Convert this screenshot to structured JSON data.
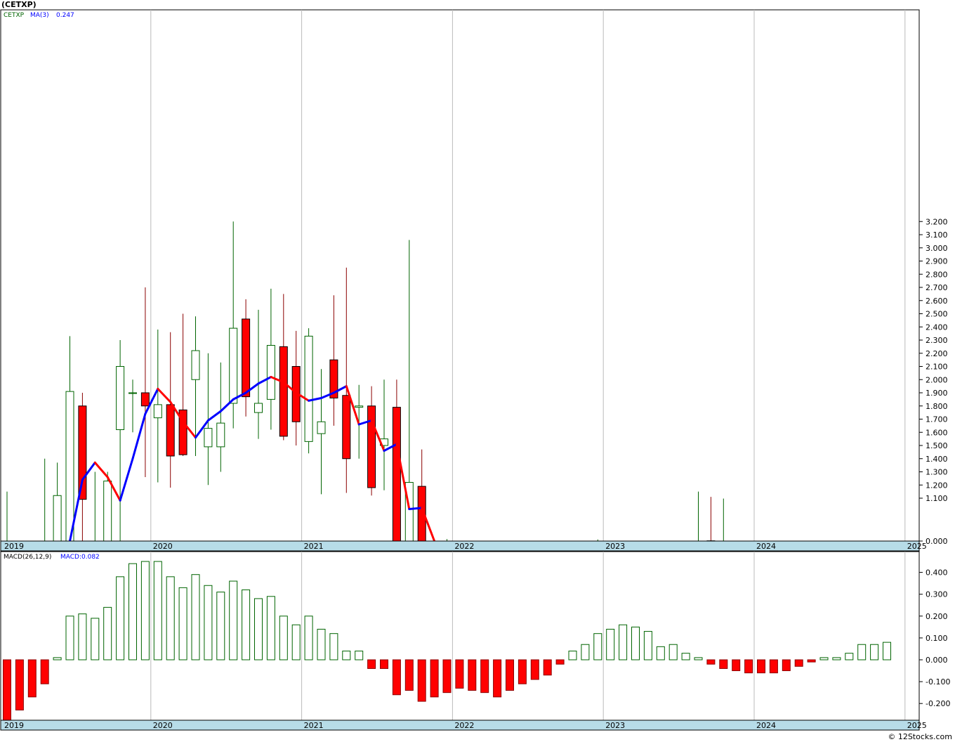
{
  "header": {
    "symbol": "(CETXP)"
  },
  "price_legend": {
    "symbol": "CETXP",
    "ma_label": "MA(3)",
    "ma_value": "0.247"
  },
  "macd_legend": {
    "label": "MACD(26,12,9)",
    "value": "MACD:0.082"
  },
  "credit": "© 12Stocks.com",
  "colors": {
    "up": "#006400",
    "down": "#ff0000",
    "ma_up": "#0000ff",
    "ma_down": "#ff0000",
    "axis_band": "#b7dce8",
    "grid": "#bbbbbb",
    "legend_text": "#2020c0"
  },
  "chart_data": [
    {
      "type": "candlestick",
      "title": "(CETXP)",
      "interval": "monthly",
      "x_range": [
        "2019-01",
        "2025-12"
      ],
      "ylim": [
        0.0,
        3.25
      ],
      "y_ticks": [
        "0.000",
        "1.100",
        "1.200",
        "1.300",
        "1.400",
        "1.500",
        "1.600",
        "1.700",
        "1.800",
        "1.900",
        "2.000",
        "2.100",
        "2.200",
        "2.300",
        "2.400",
        "2.500",
        "2.600",
        "2.700",
        "2.800",
        "2.900",
        "3.000",
        "3.100",
        "3.200"
      ],
      "x_labels": [
        "2019",
        "2020",
        "2021",
        "2022",
        "2023",
        "2024",
        "2025"
      ],
      "candles": [
        {
          "date": "2019-01",
          "open": 0.0,
          "high": 1.15,
          "low": 0.0,
          "close": 0.0
        },
        {
          "date": "2019-04",
          "open": 0.0,
          "high": 1.4,
          "low": 0.0,
          "close": 0.0
        },
        {
          "date": "2019-05",
          "open": 0.0,
          "high": 1.37,
          "low": 0.0,
          "close": 1.12
        },
        {
          "date": "2019-06",
          "open": 0.0,
          "high": 2.33,
          "low": 0.0,
          "close": 1.91
        },
        {
          "date": "2019-07",
          "open": 1.8,
          "high": 1.9,
          "low": 0.0,
          "close": 1.07
        },
        {
          "date": "2019-08",
          "open": 0.0,
          "high": 1.3,
          "low": 0.0,
          "close": 0.0
        },
        {
          "date": "2019-09",
          "open": 0.0,
          "high": 1.3,
          "low": 0.0,
          "close": 1.23
        },
        {
          "date": "2019-10",
          "open": 1.62,
          "high": 2.3,
          "low": 0.0,
          "close": 2.1
        },
        {
          "date": "2019-11",
          "open": 1.9,
          "high": 2.0,
          "low": 1.6,
          "close": 1.9
        },
        {
          "date": "2019-12",
          "open": 1.9,
          "high": 2.7,
          "low": 1.26,
          "close": 1.8
        },
        {
          "date": "2020-01",
          "open": 1.71,
          "high": 2.38,
          "low": 1.22,
          "close": 1.81
        },
        {
          "date": "2020-02",
          "open": 1.81,
          "high": 2.36,
          "low": 1.18,
          "close": 1.42
        },
        {
          "date": "2020-03",
          "open": 1.77,
          "high": 2.5,
          "low": 1.42,
          "close": 1.43
        },
        {
          "date": "2020-04",
          "open": 2.0,
          "high": 2.48,
          "low": 1.42,
          "close": 2.22
        },
        {
          "date": "2020-05",
          "open": 1.49,
          "high": 2.2,
          "low": 1.2,
          "close": 1.63
        },
        {
          "date": "2020-06",
          "open": 1.49,
          "high": 2.13,
          "low": 1.3,
          "close": 1.67
        },
        {
          "date": "2020-07",
          "open": 1.82,
          "high": 3.2,
          "low": 1.63,
          "close": 2.39
        },
        {
          "date": "2020-08",
          "open": 2.46,
          "high": 2.61,
          "low": 1.72,
          "close": 1.87
        },
        {
          "date": "2020-09",
          "open": 1.75,
          "high": 2.53,
          "low": 1.55,
          "close": 1.82
        },
        {
          "date": "2020-10",
          "open": 1.85,
          "high": 2.69,
          "low": 1.62,
          "close": 2.26
        },
        {
          "date": "2020-11",
          "open": 2.25,
          "high": 2.65,
          "low": 1.54,
          "close": 1.57
        },
        {
          "date": "2020-12",
          "open": 2.1,
          "high": 2.37,
          "low": 1.5,
          "close": 1.68
        },
        {
          "date": "2021-01",
          "open": 1.53,
          "high": 2.39,
          "low": 1.44,
          "close": 2.33
        },
        {
          "date": "2021-02",
          "open": 1.59,
          "high": 2.08,
          "low": 1.13,
          "close": 1.68
        },
        {
          "date": "2021-03",
          "open": 2.15,
          "high": 2.64,
          "low": 1.65,
          "close": 1.86
        },
        {
          "date": "2021-04",
          "open": 1.88,
          "high": 2.85,
          "low": 1.14,
          "close": 1.4
        },
        {
          "date": "2021-05",
          "open": 1.79,
          "high": 1.96,
          "low": 1.4,
          "close": 1.8
        },
        {
          "date": "2021-06",
          "open": 1.8,
          "high": 1.95,
          "low": 1.12,
          "close": 1.18
        },
        {
          "date": "2021-07",
          "open": 1.5,
          "high": 2.0,
          "low": 1.16,
          "close": 1.55
        },
        {
          "date": "2021-08",
          "open": 1.79,
          "high": 2.0,
          "low": 0.0,
          "close": 0.0
        },
        {
          "date": "2021-09",
          "open": 0.0,
          "high": 3.06,
          "low": 0.0,
          "close": 1.22
        },
        {
          "date": "2021-10",
          "open": 1.19,
          "high": 1.47,
          "low": 0.0,
          "close": 0.0
        },
        {
          "date": "2021-11",
          "open": 0.0,
          "high": 0.02,
          "low": 0.0,
          "close": 0.0
        },
        {
          "date": "2021-12",
          "open": 0.0,
          "high": 0.05,
          "low": 0.0,
          "close": 0.0
        },
        {
          "date": "2022-12",
          "open": 0.0,
          "high": 0.04,
          "low": 0.0,
          "close": 0.0
        },
        {
          "date": "2023-08",
          "open": 0.0,
          "high": 1.15,
          "low": 0.0,
          "close": 0.0
        },
        {
          "date": "2023-09",
          "open": 0.006,
          "high": 1.11,
          "low": 0.0,
          "close": 0.0
        },
        {
          "date": "2023-10",
          "open": 0.0,
          "high": 1.09,
          "low": 0.0,
          "close": 0.0
        }
      ],
      "moving_average": {
        "name": "MA(3)",
        "values": [
          {
            "date": "2019-06",
            "value": 0.0
          },
          {
            "date": "2019-07",
            "value": 1.24
          },
          {
            "date": "2019-08",
            "value": 1.37
          },
          {
            "date": "2019-09",
            "value": 1.26
          },
          {
            "date": "2019-10",
            "value": 1.04
          },
          {
            "date": "2019-11",
            "value": 1.4
          },
          {
            "date": "2019-12",
            "value": 1.74
          },
          {
            "date": "2020-01",
            "value": 1.93
          },
          {
            "date": "2020-02",
            "value": 1.83
          },
          {
            "date": "2020-03",
            "value": 1.68
          },
          {
            "date": "2020-04",
            "value": 1.56
          },
          {
            "date": "2020-05",
            "value": 1.69
          },
          {
            "date": "2020-06",
            "value": 1.76
          },
          {
            "date": "2020-07",
            "value": 1.85
          },
          {
            "date": "2020-08",
            "value": 1.9
          },
          {
            "date": "2020-09",
            "value": 1.97
          },
          {
            "date": "2020-10",
            "value": 2.02
          },
          {
            "date": "2020-11",
            "value": 1.98
          },
          {
            "date": "2020-12",
            "value": 1.9
          },
          {
            "date": "2021-01",
            "value": 1.84
          },
          {
            "date": "2021-02",
            "value": 1.86
          },
          {
            "date": "2021-03",
            "value": 1.9
          },
          {
            "date": "2021-04",
            "value": 1.95
          },
          {
            "date": "2021-05",
            "value": 1.66
          },
          {
            "date": "2021-06",
            "value": 1.69
          },
          {
            "date": "2021-07",
            "value": 1.46
          },
          {
            "date": "2021-08",
            "value": 1.51
          },
          {
            "date": "2021-09",
            "value": 0.82
          },
          {
            "date": "2021-10",
            "value": 0.85
          },
          {
            "date": "2021-11",
            "value": 0.0
          }
        ]
      }
    },
    {
      "type": "bar",
      "title": "MACD(26,12,9)",
      "interval": "monthly",
      "ylim": [
        -0.28,
        0.46
      ],
      "y_ticks": [
        "0.400",
        "0.300",
        "0.200",
        "0.100",
        "0.000",
        "-0.100",
        "-0.200"
      ],
      "x_labels": [
        "2019",
        "2020",
        "2021",
        "2022",
        "2023",
        "2024",
        "2025"
      ],
      "values": [
        {
          "date": "2019-01",
          "value": -0.28
        },
        {
          "date": "2019-02",
          "value": -0.23
        },
        {
          "date": "2019-03",
          "value": -0.17
        },
        {
          "date": "2019-04",
          "value": -0.11
        },
        {
          "date": "2019-05",
          "value": 0.01
        },
        {
          "date": "2019-06",
          "value": 0.2
        },
        {
          "date": "2019-07",
          "value": 0.21
        },
        {
          "date": "2019-08",
          "value": 0.19
        },
        {
          "date": "2019-09",
          "value": 0.24
        },
        {
          "date": "2019-10",
          "value": 0.38
        },
        {
          "date": "2019-11",
          "value": 0.44
        },
        {
          "date": "2019-12",
          "value": 0.45
        },
        {
          "date": "2020-01",
          "value": 0.45
        },
        {
          "date": "2020-02",
          "value": 0.38
        },
        {
          "date": "2020-03",
          "value": 0.33
        },
        {
          "date": "2020-04",
          "value": 0.39
        },
        {
          "date": "2020-05",
          "value": 0.34
        },
        {
          "date": "2020-06",
          "value": 0.31
        },
        {
          "date": "2020-07",
          "value": 0.36
        },
        {
          "date": "2020-08",
          "value": 0.32
        },
        {
          "date": "2020-09",
          "value": 0.28
        },
        {
          "date": "2020-10",
          "value": 0.29
        },
        {
          "date": "2020-11",
          "value": 0.2
        },
        {
          "date": "2020-12",
          "value": 0.16
        },
        {
          "date": "2021-01",
          "value": 0.2
        },
        {
          "date": "2021-02",
          "value": 0.14
        },
        {
          "date": "2021-03",
          "value": 0.12
        },
        {
          "date": "2021-04",
          "value": 0.04
        },
        {
          "date": "2021-05",
          "value": 0.04
        },
        {
          "date": "2021-06",
          "value": -0.04
        },
        {
          "date": "2021-07",
          "value": -0.04
        },
        {
          "date": "2021-08",
          "value": -0.16
        },
        {
          "date": "2021-09",
          "value": -0.14
        },
        {
          "date": "2021-10",
          "value": -0.19
        },
        {
          "date": "2021-11",
          "value": -0.17
        },
        {
          "date": "2021-12",
          "value": -0.15
        },
        {
          "date": "2022-01",
          "value": -0.13
        },
        {
          "date": "2022-02",
          "value": -0.14
        },
        {
          "date": "2022-03",
          "value": -0.15
        },
        {
          "date": "2022-04",
          "value": -0.17
        },
        {
          "date": "2022-05",
          "value": -0.14
        },
        {
          "date": "2022-06",
          "value": -0.11
        },
        {
          "date": "2022-07",
          "value": -0.09
        },
        {
          "date": "2022-08",
          "value": -0.07
        },
        {
          "date": "2022-09",
          "value": -0.02
        },
        {
          "date": "2022-10",
          "value": 0.04
        },
        {
          "date": "2022-11",
          "value": 0.07
        },
        {
          "date": "2022-12",
          "value": 0.12
        },
        {
          "date": "2023-01",
          "value": 0.14
        },
        {
          "date": "2023-02",
          "value": 0.16
        },
        {
          "date": "2023-03",
          "value": 0.15
        },
        {
          "date": "2023-04",
          "value": 0.13
        },
        {
          "date": "2023-05",
          "value": 0.06
        },
        {
          "date": "2023-06",
          "value": 0.07
        },
        {
          "date": "2023-07",
          "value": 0.03
        },
        {
          "date": "2023-08",
          "value": 0.01
        },
        {
          "date": "2023-09",
          "value": -0.02
        },
        {
          "date": "2023-10",
          "value": -0.04
        },
        {
          "date": "2023-11",
          "value": -0.05
        },
        {
          "date": "2023-12",
          "value": -0.06
        },
        {
          "date": "2024-01",
          "value": -0.06
        },
        {
          "date": "2024-02",
          "value": -0.06
        },
        {
          "date": "2024-03",
          "value": -0.05
        },
        {
          "date": "2024-04",
          "value": -0.03
        },
        {
          "date": "2024-05",
          "value": -0.01
        },
        {
          "date": "2024-06",
          "value": 0.01
        },
        {
          "date": "2024-07",
          "value": 0.01
        },
        {
          "date": "2024-08",
          "value": 0.03
        },
        {
          "date": "2024-09",
          "value": 0.07
        },
        {
          "date": "2024-10",
          "value": 0.07
        },
        {
          "date": "2024-11",
          "value": 0.08
        }
      ]
    }
  ]
}
